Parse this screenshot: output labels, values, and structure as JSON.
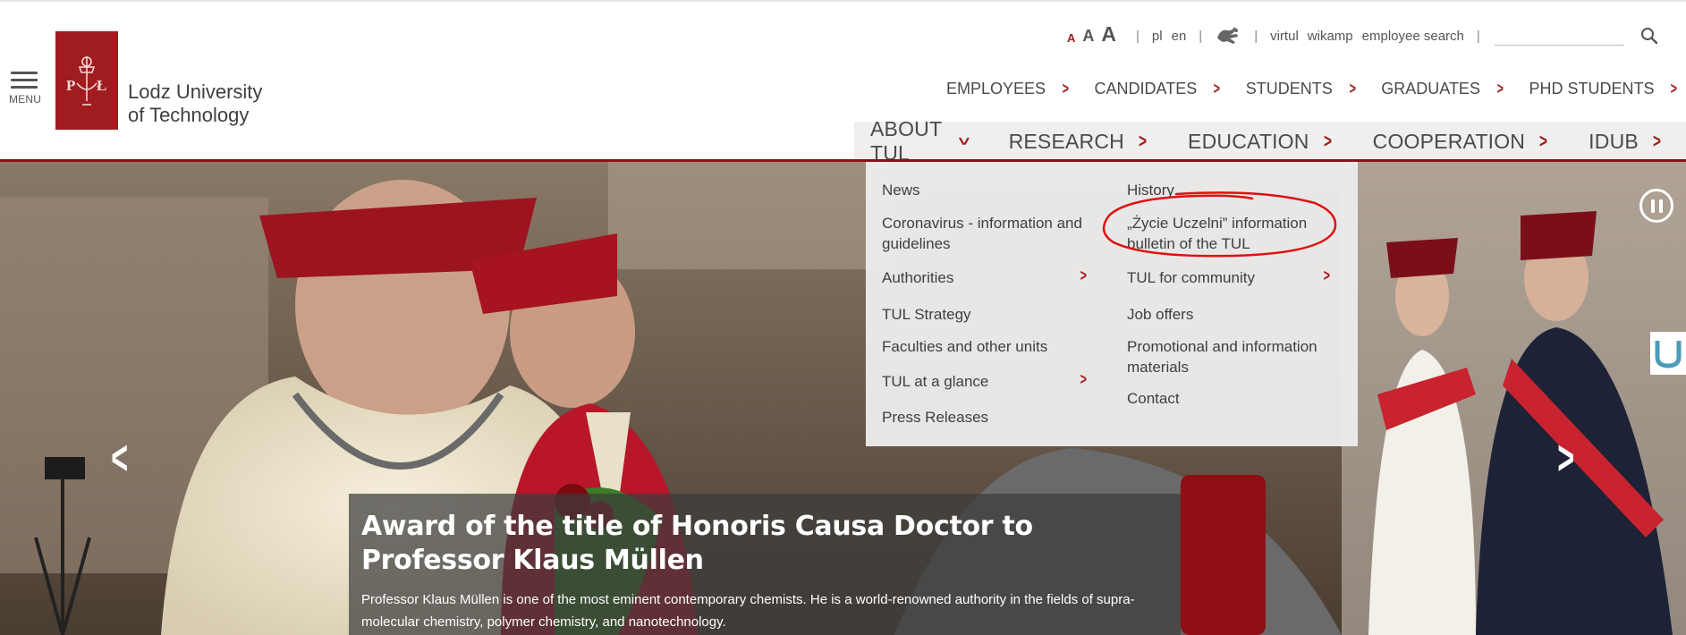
{
  "header": {
    "menu_label": "MENU",
    "logo_line1": "Lodz University",
    "logo_line2": "of Technology",
    "logo_letters": "P Ł",
    "font_size_labels": [
      "A",
      "A",
      "A"
    ],
    "languages": [
      "pl",
      "en"
    ],
    "utility_links": [
      "virtul",
      "wikamp",
      "employee search"
    ],
    "search_placeholder": ""
  },
  "audience_nav": [
    "EMPLOYEES",
    "CANDIDATES",
    "STUDENTS",
    "GRADUATES",
    "PHD STUDENTS"
  ],
  "main_nav": [
    "ABOUT TUL",
    "RESEARCH",
    "EDUCATION",
    "COOPERATION",
    "IDUB"
  ],
  "dropdown": {
    "col1": [
      "News",
      "Coronavirus - information and guidelines",
      "Authorities",
      "TUL Strategy",
      "Faculties and other units",
      "TUL at a glance",
      "Press Releases"
    ],
    "col2": [
      "History",
      "„Życie Uczelni” information bulletin of the TUL",
      "TUL for community",
      "Job offers",
      "Promotional and information materials",
      "Contact"
    ]
  },
  "slide": {
    "title": "Award of the title of Honoris Causa Doctor to Professor Klaus Müllen",
    "description": "Professor Klaus Müllen is one of the most eminent contemporary chemists. He is a world-renowned authority in the fields of supra-molecular chemistry, polymer chemistry, and nanotechnology."
  },
  "colors": {
    "brand_red": "#a01c1e",
    "nav_underline": "#8b1214",
    "annotation": "#e01010"
  }
}
